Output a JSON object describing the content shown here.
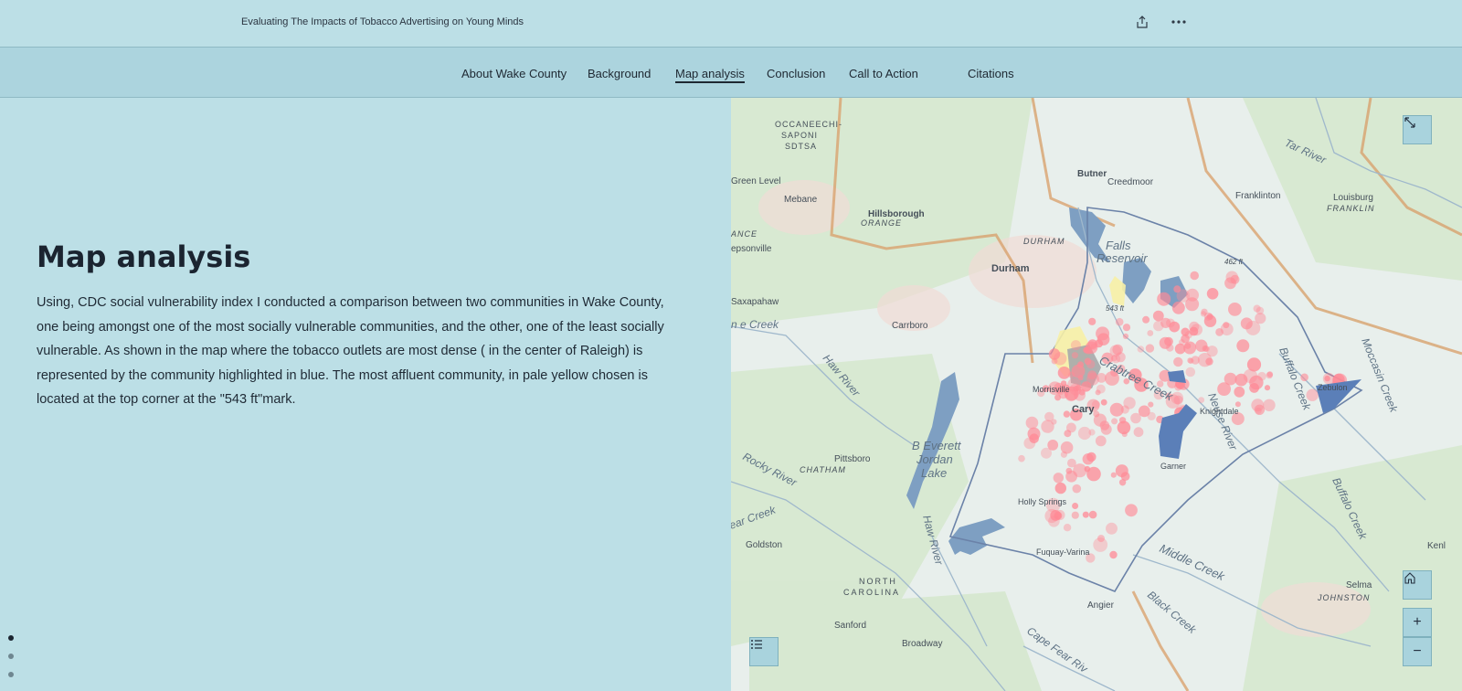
{
  "header": {
    "title": "Evaluating The Impacts of Tobacco Advertising on Young Minds",
    "share_icon": "share-icon",
    "more_icon": "more-options-icon"
  },
  "nav": {
    "items": [
      {
        "label": "About Wake County",
        "active": false
      },
      {
        "label": "Background",
        "active": false
      },
      {
        "label": "Map analysis",
        "active": true
      },
      {
        "label": "Conclusion",
        "active": false
      },
      {
        "label": "Call to Action",
        "active": false
      },
      {
        "label": "Citations",
        "active": false
      }
    ]
  },
  "section": {
    "heading": "Map analysis",
    "body": "Using, CDC social vulnerability index I conducted a comparison between two communities in Wake County, one being amongst one of the most socially vulnerable communities, and the other, one of the least socially vulnerable. As shown in the map where the tobacco outlets are most dense ( in the center of Raleigh) is represented by the community highlighted in blue. The most affluent community, in pale yellow chosen is located at the top corner at the \"543 ft\"mark."
  },
  "progress": {
    "total": 3,
    "current": 1
  },
  "map": {
    "labels": {
      "occaneechi1": "OCCANEECHI-",
      "occaneechi2": "SAPONI",
      "occaneechi3": "SDTSA",
      "green_level": "Green Level",
      "mebane": "Mebane",
      "hillsborough": "Hillsborough",
      "orange": "ORANGE",
      "durham_county": "DURHAM",
      "durham": "Durham",
      "butner": "Butner",
      "creedmoor": "Creedmoor",
      "franklinton": "Franklinton",
      "louisburg": "Louisburg",
      "franklin": "FRANKLIN",
      "tar_river": "Tar River",
      "falls": "Falls",
      "reservoir": "Reservoir",
      "ft462": "462 ft",
      "ft543": "543 ft",
      "saxapahaw": "Saxapahaw",
      "carrboro": "Carrboro",
      "ance": "ANCE",
      "epsonville": "epsonville",
      "ne_creek": "n e Creek",
      "haw_river": "Haw River",
      "morrisville": "Morrisville",
      "cary": "Cary",
      "crabtree": "Crabtree Creek",
      "neuse": "Neuse River",
      "knightdale": "Knightdale",
      "zebulon": "Zebulon",
      "buffalo": "Buffalo Creek",
      "moccasin": "Moccasin Creek",
      "garner": "Garner",
      "pittsboro": "Pittsboro",
      "chatham": "CHATHAM",
      "rocky_river": "Rocky River",
      "b_everett": "B Everett",
      "jordan": "Jordan",
      "lake": "Lake",
      "holly_springs": "Holly Springs",
      "bear_creek": "ear Creek",
      "haw_river2": "Haw River",
      "goldston": "Goldston",
      "fuquay": "Fuquay-Varina",
      "middle_creek": "Middle Creek",
      "buffalo2": "Buffalo Creek",
      "north": "NORTH",
      "carolina": "CAROLINA",
      "selma": "Selma",
      "johnston": "JOHNSTON",
      "kenly": "Kenl",
      "angier": "Angier",
      "black_creek": "Black Creek",
      "sanford": "Sanford",
      "broadway": "Broadway",
      "cape_fear": "Cape Fear Riv"
    },
    "colors": {
      "high_vulnerability": "#5b7fb8",
      "low_vulnerability": "#f7f0a6",
      "outlet_density": "#ff8a96",
      "county_outline": "#6b82a8"
    },
    "controls": {
      "expand": "expand-icon",
      "home": "home-icon",
      "zoom_in": "+",
      "zoom_out": "−",
      "legend": "legend-icon"
    }
  }
}
